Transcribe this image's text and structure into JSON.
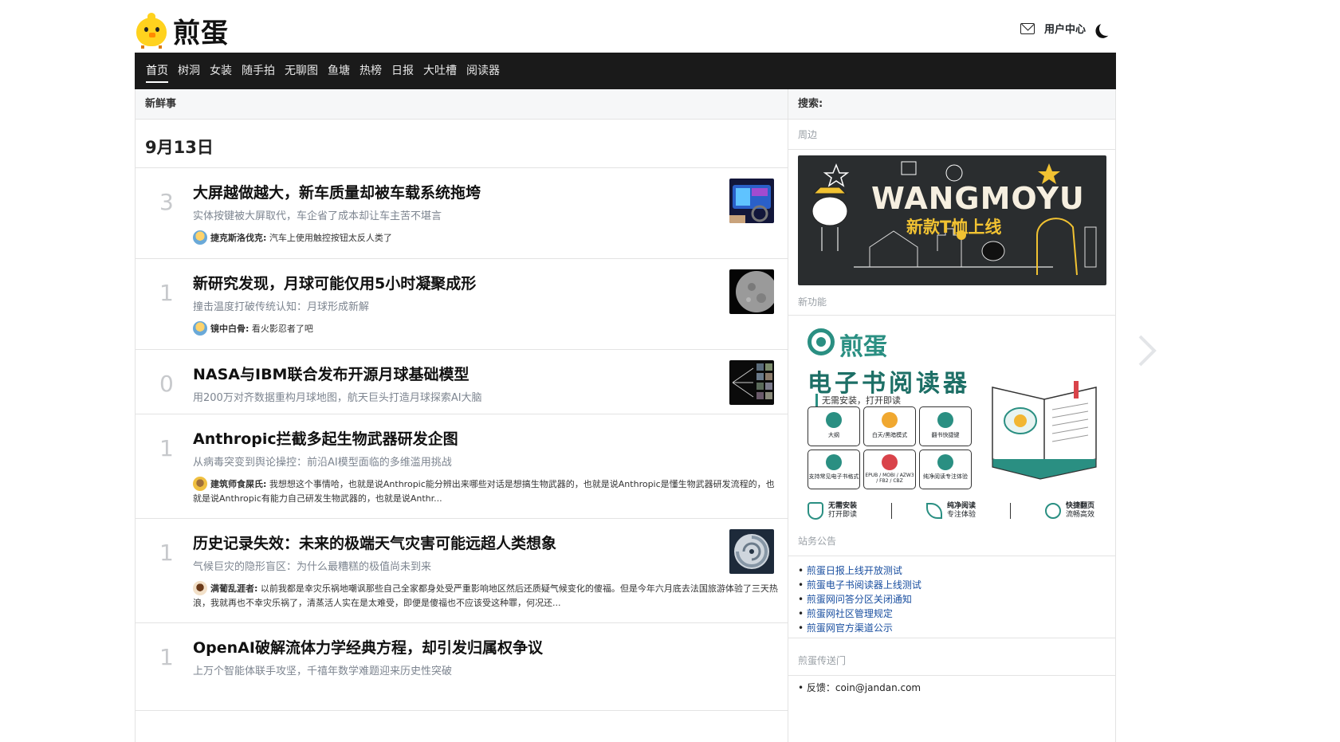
{
  "site": {
    "logo_text": "煎蛋"
  },
  "header": {
    "user_center": "用户中心"
  },
  "nav": {
    "items": [
      "首页",
      "树洞",
      "女装",
      "随手拍",
      "无聊图",
      "鱼塘",
      "热榜",
      "日报",
      "大吐槽",
      "阅读器"
    ]
  },
  "main": {
    "section_title": "新鲜事",
    "date": "9月13日",
    "posts": [
      {
        "count": "3",
        "title": "大屏越做越大，新车质量却被车载系统拖垮",
        "subtitle": "实体按键被大屏取代，车企省了成本却让车主苦不堪言",
        "comment_user": "捷克斯洛伐克:",
        "comment_text": "汽车上使用触控按钮太反人类了"
      },
      {
        "count": "1",
        "title": "新研究发现，月球可能仅用5小时凝聚成形",
        "subtitle": "撞击温度打破传统认知：月球形成新解",
        "comment_user": "镜中白骨:",
        "comment_text": "看火影忍者了吧"
      },
      {
        "count": "0",
        "title": "NASA与IBM联合发布开源月球基础模型",
        "subtitle": "用200万对齐数据重构月球地图，航天巨头打造月球探索AI大脑"
      },
      {
        "count": "1",
        "title": "Anthropic拦截多起生物武器研发企图",
        "subtitle": "从病毒突变到舆论操控：前沿AI模型面临的多维滥用挑战",
        "comment_user": "建筑师食屎氏:",
        "comment_text": "我想想这个事情哈，也就是说Anthropic能分辨出来哪些对话是想搞生物武器的，也就是说Anthropic是懂生物武器研发流程的，也就是说Anthropic有能力自己研发生物武器的，也就是说Anthr..."
      },
      {
        "count": "1",
        "title": "历史记录失效：未来的极端天气灾害可能远超人类想象",
        "subtitle": "气候巨灾的隐形盲区：为什么最糟糕的极值尚未到来",
        "comment_user": "满葡乱涯者:",
        "comment_text": "以前我都是幸灾乐祸地嘲讽那些自己全家都身处受严重影响地区然后还质疑气候变化的傻福。但是今年六月底去法国旅游体验了三天热浪，我就再也不幸灾乐祸了，清蒸活人实在是太难受，即便是傻福也不应该受这种罪，何况还..."
      },
      {
        "count": "1",
        "title": "OpenAI破解流体力学经典方程，却引发归属权争议",
        "subtitle": "上万个智能体联手攻坚，千禧年数学难题迎来历史性突破"
      }
    ]
  },
  "side": {
    "search_label": "搜索:",
    "periphery_label": "周边",
    "banner1": {
      "brand": "WANGMOYU",
      "tagline": "新款T恤上线"
    },
    "new_feature_label": "新功能",
    "banner2": {
      "brand": "煎蛋",
      "title": "电子书阅读器",
      "subtitle": "无需安装，打开即读",
      "features": [
        "大纲",
        "白天/黑暗模式",
        "翻书快捷键",
        "支持常见电子书格式",
        "EPUB / MOBI / AZW3 / FB2 / CBZ",
        "纯净阅读专注体验"
      ],
      "footer": [
        {
          "title": "无需安装",
          "sub": "打开即读"
        },
        {
          "title": "纯净阅读",
          "sub": "专注体验"
        },
        {
          "title": "快捷翻页",
          "sub": "流畅高效"
        }
      ]
    },
    "announce_label": "站务公告",
    "announcements": [
      "煎蛋日报上线开放测试",
      "煎蛋电子书阅读器上线测试",
      "煎蛋网问答分区关闭通知",
      "煎蛋网社区管理规定",
      "煎蛋网官方渠道公示"
    ],
    "portal_label": "煎蛋传送门",
    "portal_first": "反馈：",
    "portal_first_value": "coin@jandan.com"
  }
}
